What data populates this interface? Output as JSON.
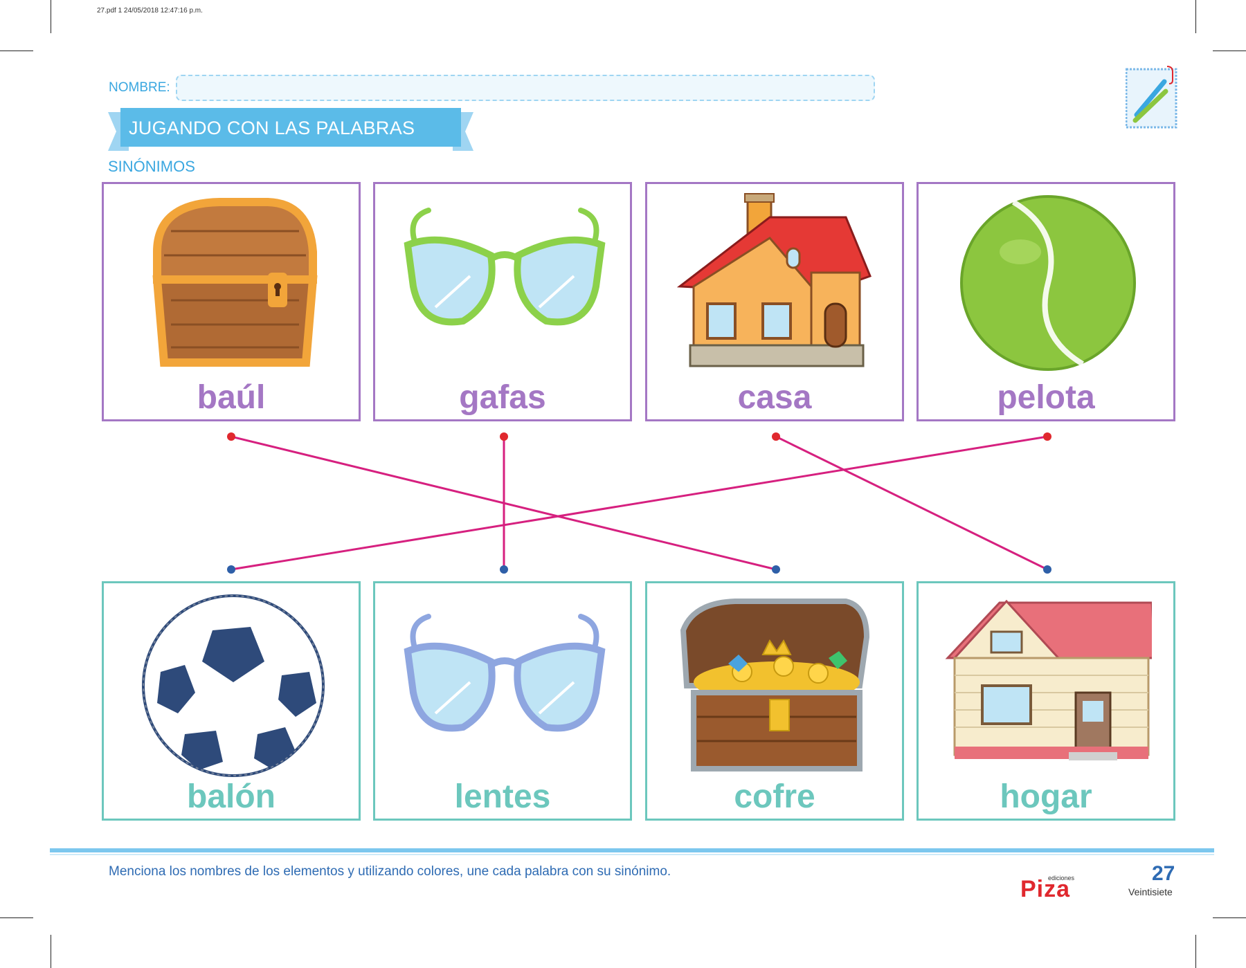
{
  "print_info": "27.pdf   1   24/05/2018   12:47:16 p.m.",
  "form": {
    "nombre_label": "NOMBRE:"
  },
  "header": {
    "title": "JUGANDO CON LAS PALABRAS",
    "subtitle": "SINÓNIMOS"
  },
  "top_cards": [
    {
      "word": "baúl",
      "image": "closed-wooden-chest"
    },
    {
      "word": "gafas",
      "image": "green-glasses"
    },
    {
      "word": "casa",
      "image": "red-roof-house"
    },
    {
      "word": "pelota",
      "image": "tennis-ball"
    }
  ],
  "bottom_cards": [
    {
      "word": "balón",
      "image": "soccer-ball"
    },
    {
      "word": "lentes",
      "image": "blue-glasses"
    },
    {
      "word": "cofre",
      "image": "open-treasure-chest"
    },
    {
      "word": "hogar",
      "image": "pink-roof-house"
    }
  ],
  "matches": [
    {
      "from": "baúl",
      "to": "cofre"
    },
    {
      "from": "gafas",
      "to": "lentes"
    },
    {
      "from": "casa",
      "to": "hogar"
    },
    {
      "from": "pelota",
      "to": "balón"
    }
  ],
  "colors": {
    "top": "#a477c4",
    "bottom": "#6cc7bd",
    "line": "#d6207f",
    "dot_top": "#e0282e",
    "dot_bottom": "#2e5fa8",
    "accent": "#3aa7e0"
  },
  "footer": {
    "instruction": "Menciona los nombres de los elementos y utilizando colores, une cada palabra con su sinónimo.",
    "publisher_small": "ediciones",
    "publisher": "Piza",
    "page_number": "27",
    "page_word": "Veintisiete"
  }
}
